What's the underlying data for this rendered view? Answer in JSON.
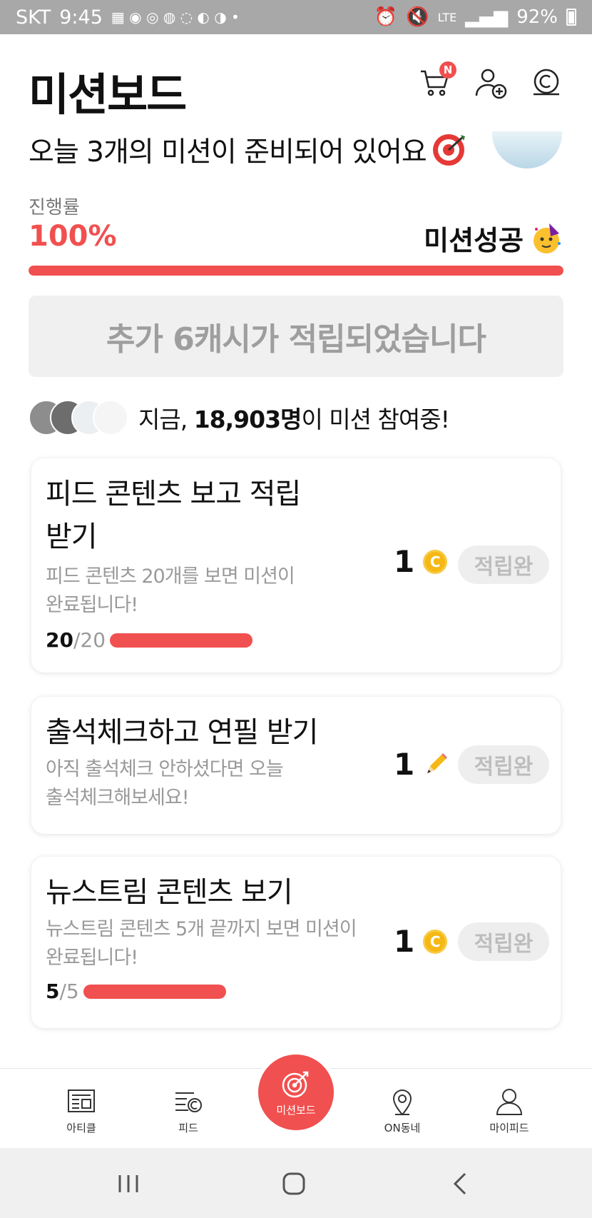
{
  "status_bar": {
    "carrier": "SKT",
    "time": "9:45",
    "battery": "92%",
    "network": "LTE"
  },
  "header": {
    "title": "미션보드",
    "cart_badge": "N"
  },
  "headline": "오늘 3개의 미션이 준비되어 있어요",
  "progress": {
    "label": "진행률",
    "value": "100%",
    "fraction": 1.0,
    "status": "미션성공"
  },
  "bonus_message": "추가 6캐시가 적립되었습니다",
  "participants": {
    "prefix": "지금,",
    "count": "18,903명",
    "suffix": "이 미션 참여중!"
  },
  "missions": [
    {
      "title_line1": "피드 콘텐츠 보고 적립",
      "title_line2": "받기",
      "desc_line1": "피드 콘텐츠 20개를 보면 미션이",
      "desc_line2": "완료됩니다!",
      "progress_current": "20",
      "progress_total": "/20",
      "progress_fraction": 1.0,
      "reward": "1",
      "reward_icon": "coin-icon",
      "status": "적립완"
    },
    {
      "title_line1": "출석체크하고 연필 받기",
      "desc_line1": "아직 출석체크 안하셨다면 오늘",
      "desc_line2": "출석체크해보세요!",
      "reward": "1",
      "reward_icon": "pencil-icon",
      "status": "적립완"
    },
    {
      "title_line1": "뉴스트림 콘텐츠 보기",
      "desc_line1": "뉴스트림 콘텐츠 5개 끝까지 보면 미션이",
      "desc_line2": "완료됩니다!",
      "progress_current": "5",
      "progress_total": "/5",
      "progress_fraction": 1.0,
      "reward": "1",
      "reward_icon": "coin-icon",
      "status": "적립완"
    }
  ],
  "coin_symbol": "C",
  "bottom_nav": [
    {
      "label": "아티클",
      "icon": "article-icon"
    },
    {
      "label": "피드",
      "icon": "feed-icon"
    },
    {
      "label": "미션보드",
      "icon": "target-icon"
    },
    {
      "label": "ON동네",
      "icon": "location-pin-icon"
    },
    {
      "label": "마이피드",
      "icon": "person-icon"
    }
  ],
  "colors": {
    "accent": "#f0504f",
    "coin": "#f5b814",
    "muted_text": "#9a9a9a"
  }
}
